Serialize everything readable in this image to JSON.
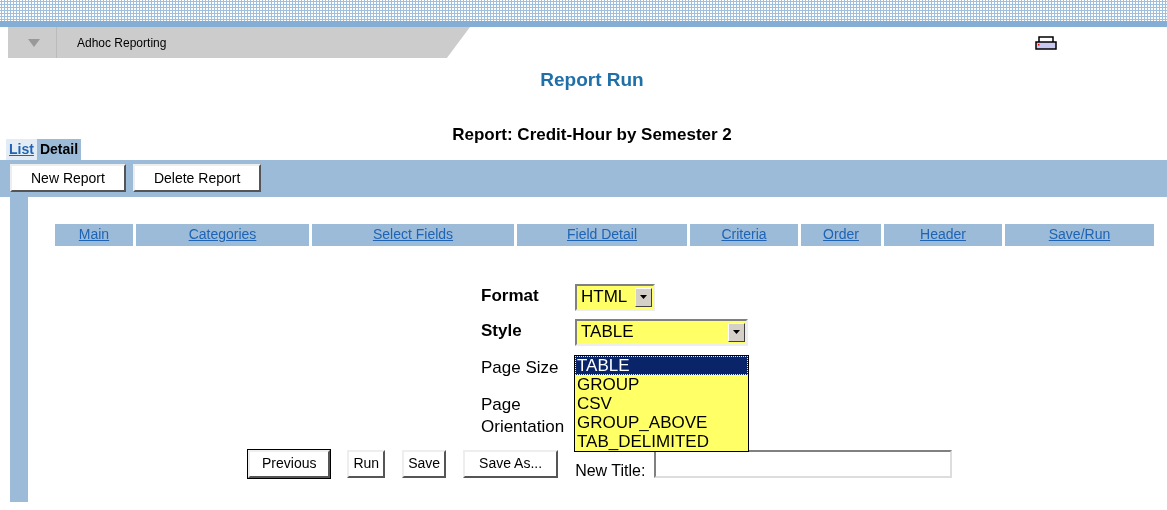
{
  "header": {
    "section": "Adhoc Reporting"
  },
  "page_title": "Report Run",
  "report_title": "Report: Credit-Hour by Semester 2",
  "tabs": [
    {
      "label": "List",
      "selected": false
    },
    {
      "label": "Detail",
      "selected": true
    }
  ],
  "toolbar": [
    "New Report",
    "Delete Report"
  ],
  "nav": [
    "Main",
    "Categories",
    "Select Fields",
    "Field Detail",
    "Criteria",
    "Order",
    "Header",
    "Save/Run"
  ],
  "form": {
    "format": {
      "label": "Format",
      "value": "HTML"
    },
    "style": {
      "label": "Style",
      "value": "TABLE",
      "options": [
        {
          "label": "TABLE",
          "selected": true
        },
        {
          "label": "GROUP",
          "selected": false
        },
        {
          "label": "CSV",
          "selected": false
        },
        {
          "label": "GROUP_ABOVE",
          "selected": false
        },
        {
          "label": "TAB_DELIMITED",
          "selected": false
        }
      ]
    },
    "page_size": {
      "label": "Page Size"
    },
    "page_orientation": {
      "label": "Page Orientation"
    }
  },
  "actions": [
    {
      "label": "Previous",
      "kind": "default"
    },
    {
      "label": "Run",
      "kind": "normal"
    },
    {
      "label": "Save",
      "kind": "normal"
    },
    {
      "label": "Save As...",
      "kind": "normal"
    }
  ],
  "new_title": {
    "label": "New Title:"
  }
}
